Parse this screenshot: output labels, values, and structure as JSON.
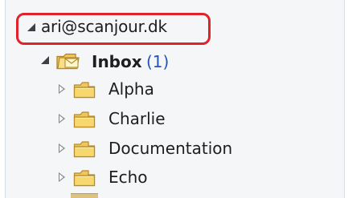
{
  "account": {
    "email": "ari@scanjour.dk",
    "expanded": true,
    "highlight_color": "#e0232a"
  },
  "inbox": {
    "label": "Inbox",
    "count": "(1)",
    "expanded": true,
    "count_color": "#2454b5",
    "icon": "inbox-folder-icon"
  },
  "folders": [
    {
      "label": "Alpha",
      "icon": "folder-icon",
      "expanded": false
    },
    {
      "label": "Charlie",
      "icon": "folder-icon",
      "expanded": false
    },
    {
      "label": "Documentation",
      "icon": "folder-icon",
      "expanded": false
    },
    {
      "label": "Echo",
      "icon": "folder-icon",
      "expanded": false
    }
  ],
  "colors": {
    "pane_background": "#f4f6f8",
    "folder_yellow": "#f7d56b",
    "folder_outline": "#b98b2b",
    "text": "#1d1d1d"
  }
}
